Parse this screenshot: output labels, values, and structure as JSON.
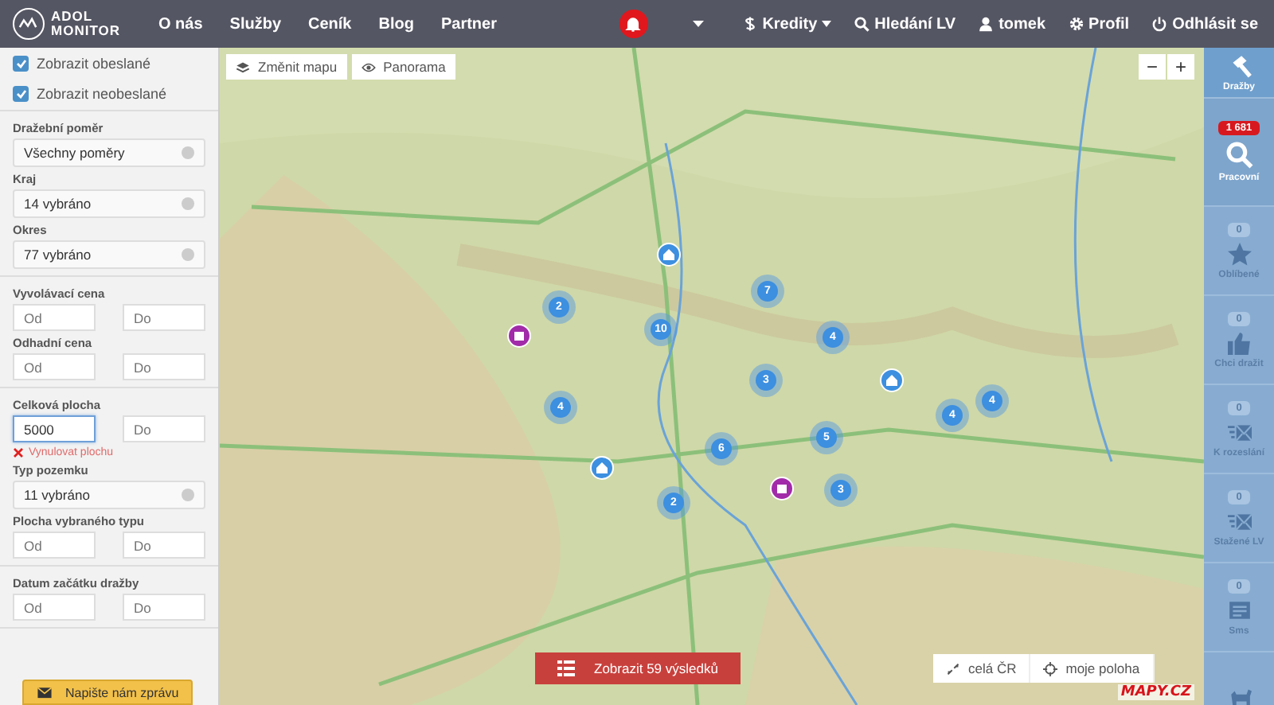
{
  "header": {
    "logo": [
      "ADOL",
      "MONITOR"
    ],
    "nav": [
      {
        "label": "O nás"
      },
      {
        "label": "Služby"
      },
      {
        "label": "Ceník"
      },
      {
        "label": "Blog"
      },
      {
        "label": "Partner"
      }
    ],
    "right_menu": [
      {
        "label": "Kredity"
      },
      {
        "label": "Hledání LV"
      },
      {
        "label": "tomek"
      },
      {
        "label": "Profil"
      },
      {
        "label": "Odhlásit se"
      }
    ]
  },
  "sidebar": {
    "checkboxes": [
      {
        "label": "Zobrazit obeslané",
        "checked": true
      },
      {
        "label": "Zobrazit neobeslané",
        "checked": true
      }
    ],
    "groups": [
      [
        {
          "kind": "select",
          "label": "Dražební poměr",
          "value": "Všechny poměry"
        },
        {
          "kind": "select",
          "label": "Kraj",
          "value": "14 vybráno"
        },
        {
          "kind": "select",
          "label": "Okres",
          "value": "77 vybráno"
        }
      ],
      [
        {
          "kind": "range",
          "label": "Vyvolávací cena",
          "inputs": [
            {
              "placeholder": "Od",
              "focused": false
            },
            {
              "placeholder": "Do",
              "focused": false
            }
          ]
        },
        {
          "kind": "range",
          "label": "Odhadní cena",
          "inputs": [
            {
              "placeholder": "Od",
              "focused": false
            },
            {
              "placeholder": "Do",
              "focused": false
            }
          ]
        }
      ],
      [
        {
          "kind": "range",
          "label": "Celková plocha",
          "inputs": [
            {
              "value": "5000",
              "focused": true
            },
            {
              "placeholder": "Do",
              "focused": false
            }
          ]
        },
        {
          "kind": "reset",
          "label": "Vynulovat plochu"
        },
        {
          "kind": "select",
          "label": "Typ pozemku",
          "value": "11 vybráno"
        },
        {
          "kind": "range",
          "label": "Plocha vybraného typu",
          "inputs": [
            {
              "placeholder": "Od",
              "focused": false
            },
            {
              "placeholder": "Do",
              "focused": false
            }
          ]
        }
      ],
      [
        {
          "kind": "range",
          "label": "Datum začátku dražby",
          "inputs": [
            {
              "placeholder": "Od",
              "focused": false
            },
            {
              "placeholder": "Do",
              "focused": false
            }
          ]
        }
      ]
    ],
    "feedback_button": "Napište nám zprávu"
  },
  "map": {
    "buttons": [
      {
        "label": "Změnit mapu"
      },
      {
        "label": "Panorama"
      }
    ],
    "zoom": [
      "−",
      "+"
    ],
    "markers": [
      {
        "kind": "cluster",
        "count": "2"
      },
      {
        "kind": "cluster",
        "count": "10"
      },
      {
        "kind": "cluster",
        "count": "7"
      },
      {
        "kind": "cluster",
        "count": "4"
      },
      {
        "kind": "cluster",
        "count": "3"
      },
      {
        "kind": "cluster",
        "count": "4"
      },
      {
        "kind": "cluster",
        "count": "6"
      },
      {
        "kind": "cluster",
        "count": "5"
      },
      {
        "kind": "cluster",
        "count": "2"
      },
      {
        "kind": "cluster",
        "count": "3"
      },
      {
        "kind": "cluster",
        "count": "4"
      },
      {
        "kind": "cluster",
        "count": "4"
      },
      {
        "kind": "house"
      },
      {
        "kind": "house"
      },
      {
        "kind": "house"
      },
      {
        "kind": "building"
      },
      {
        "kind": "building"
      }
    ],
    "results_button": "Zobrazit 59 výsledků",
    "tools": [
      {
        "label": "celá ČR"
      },
      {
        "label": "moje poloha"
      }
    ],
    "logo": "MAPY.CZ"
  },
  "rail": [
    {
      "label": "Dražby",
      "selected": true
    },
    {
      "label": "Pracovní",
      "badge": "1 681",
      "selected": false
    },
    {
      "label": "Oblíbené",
      "count": "0",
      "selected": false
    },
    {
      "label": "Chci dražit",
      "count": "0",
      "selected": false
    },
    {
      "label": "K rozeslání",
      "count": "0",
      "selected": false
    },
    {
      "label": "Stažené LV",
      "count": "0",
      "selected": false
    },
    {
      "label": "Sms",
      "count": "0",
      "selected": false
    },
    {
      "selected": false
    }
  ]
}
